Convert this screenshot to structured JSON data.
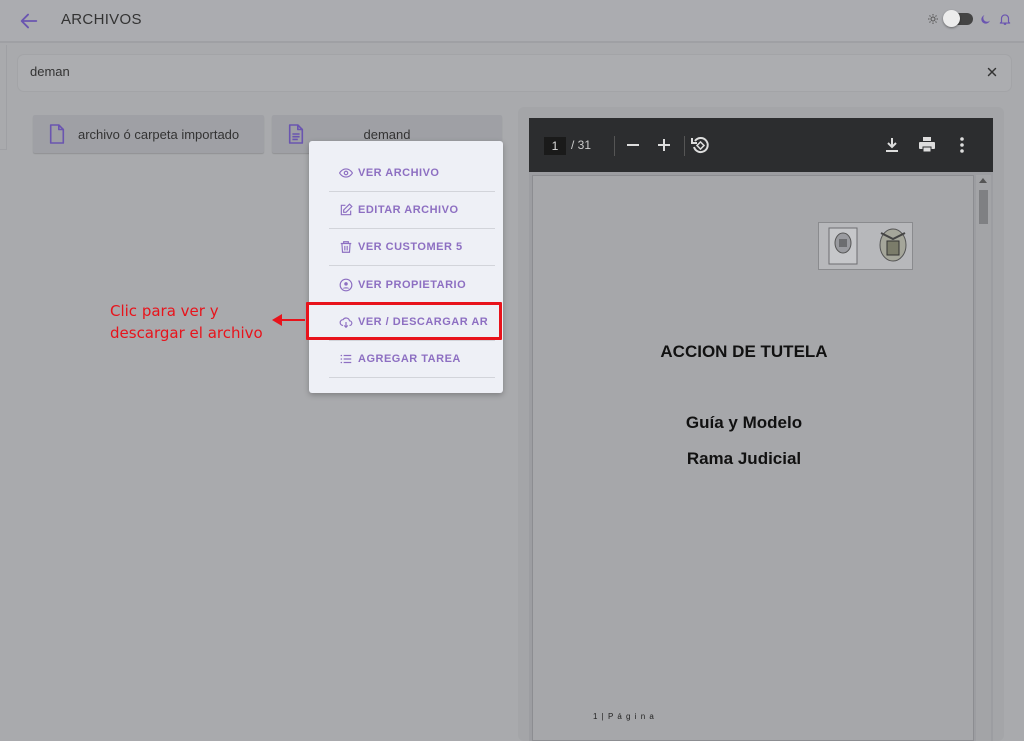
{
  "header": {
    "title": "ARCHIVOS",
    "icons": [
      "back-arrow-icon",
      "sun-icon",
      "theme-toggle",
      "moon-icon",
      "bell-icon"
    ]
  },
  "search": {
    "value": "deman",
    "clear_icon": "close-icon"
  },
  "files": [
    {
      "label": "archivo ó carpeta importado",
      "icon": "file-icon"
    },
    {
      "label": "demand",
      "icon": "document-icon"
    }
  ],
  "context_menu": {
    "items": [
      {
        "label": "VER ARCHIVO",
        "icon": "eye-icon"
      },
      {
        "label": "EDITAR ARCHIVO",
        "icon": "edit-icon"
      },
      {
        "label": "VER CUSTOMER 5",
        "icon": "trash-icon"
      },
      {
        "label": "VER PROPIETARIO",
        "icon": "user-circle-icon"
      },
      {
        "label": "VER / DESCARGAR AR",
        "icon": "cloud-download-icon"
      },
      {
        "label": "AGREGAR TAREA",
        "icon": "list-icon"
      }
    ]
  },
  "annotation": {
    "line1": "Clic para ver y",
    "line2": "descargar el archivo",
    "color": "#e8131b"
  },
  "pdf_viewer": {
    "current_page": "1",
    "total_pages": "/ 31",
    "document": {
      "title": "ACCION DE TUTELA",
      "subtitle1": "Guía y Modelo",
      "subtitle2": "Rama Judicial",
      "footer": "1 | P á g i n a"
    }
  },
  "colors": {
    "accent": "#8d6fc2",
    "menu_bg": "#eef0f6",
    "toolbar": "#2c2d2f"
  }
}
